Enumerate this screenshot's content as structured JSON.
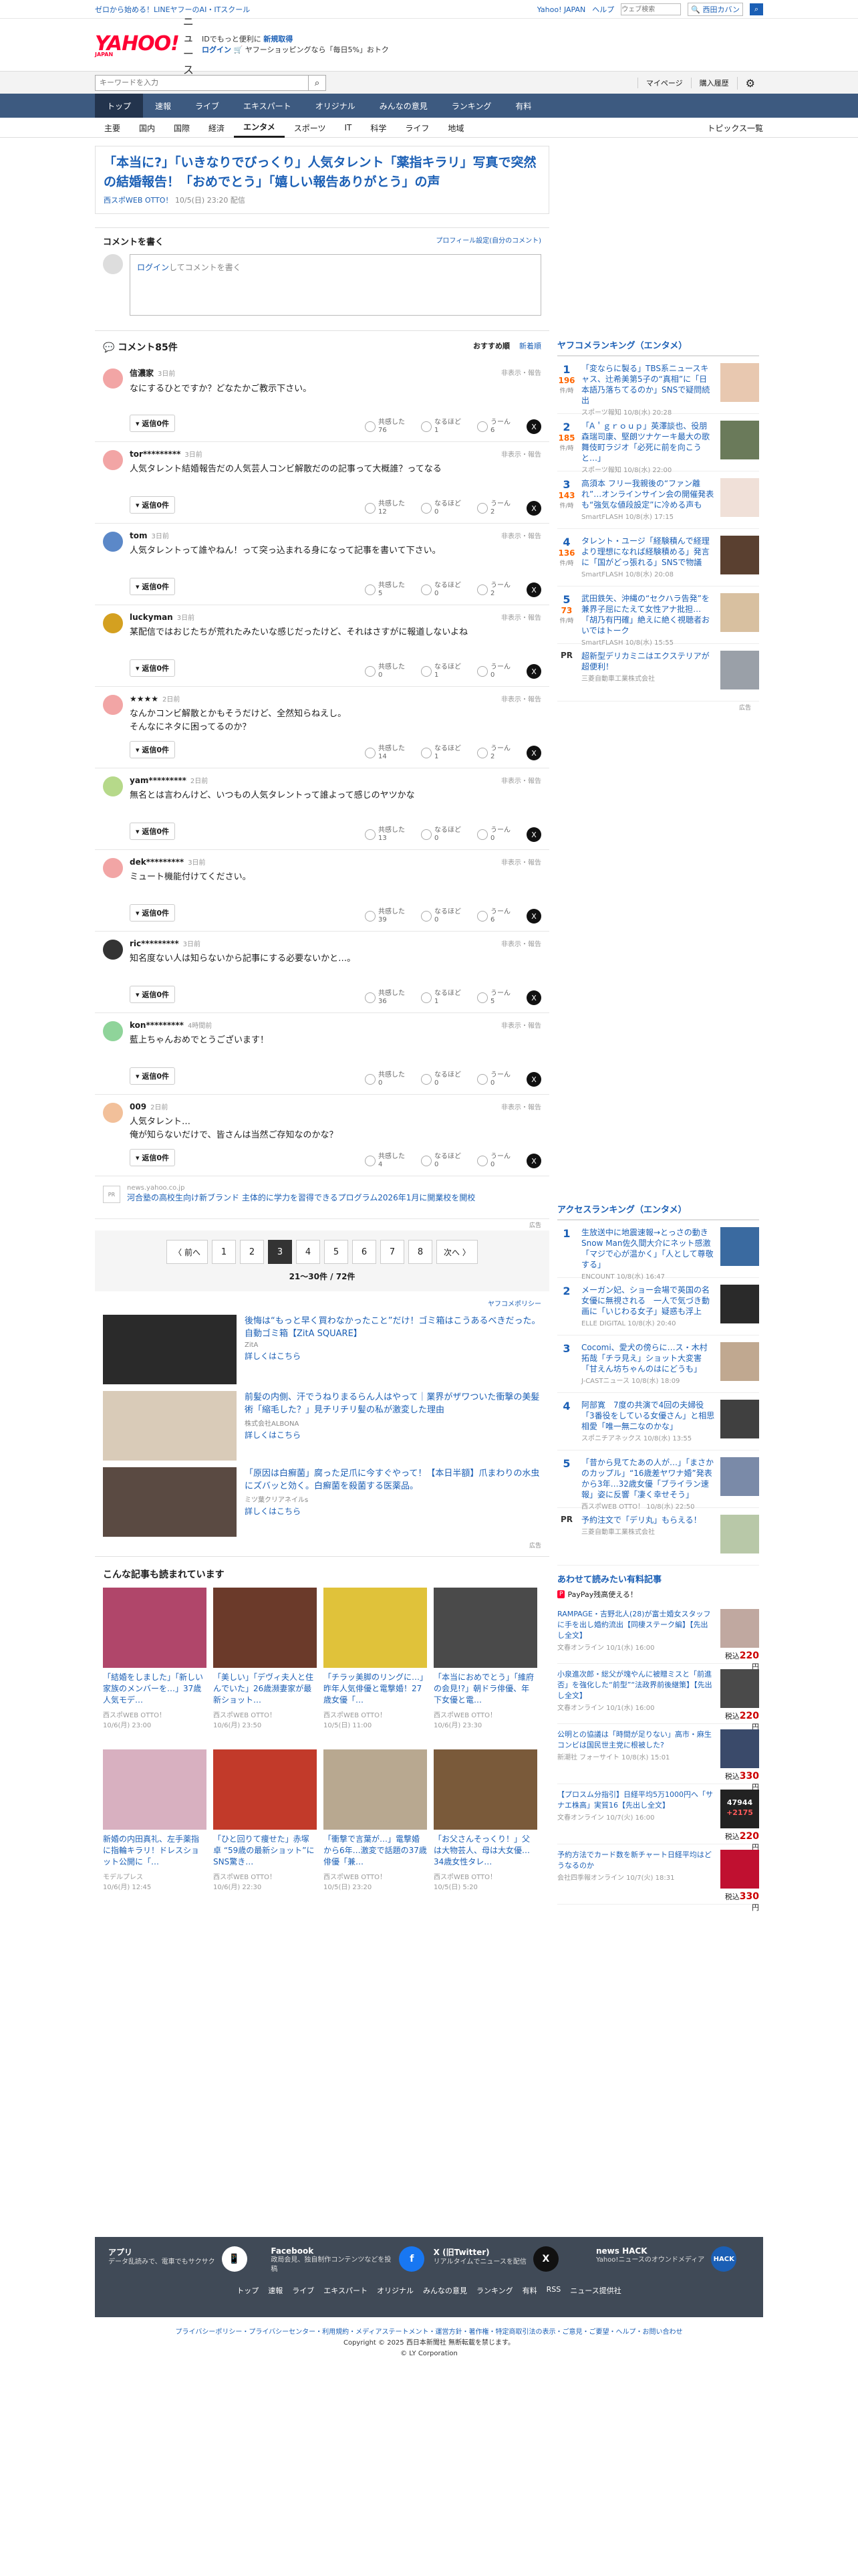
{
  "topbar": {
    "left": "ゼロから始める！LINEヤフーのAI・ITスクール",
    "links": [
      "Yahoo! JAPAN",
      "ヘルプ"
    ],
    "search_placeholder": "ウェブ検索",
    "search_select": "🔍 西田カバン"
  },
  "header": {
    "logo": "YAHOO!",
    "logo_sub": "JAPAN",
    "news": "ニュース",
    "promo_line1": "IDでもっと便利に",
    "promo_new": "新規取得",
    "promo_login": "ログイン",
    "promo_line2": "🛒 ヤフーショッピングなら「毎日5%」おトク"
  },
  "search": {
    "placeholder": "キーワードを入力",
    "right_links": [
      "マイページ",
      "購入履歴"
    ]
  },
  "gnav": [
    "トップ",
    "速報",
    "ライブ",
    "エキスパート",
    "オリジナル",
    "みんなの意見",
    "ランキング",
    "有料"
  ],
  "lnav": [
    "主要",
    "国内",
    "国際",
    "経済",
    "エンタメ",
    "スポーツ",
    "IT",
    "科学",
    "ライフ",
    "地域"
  ],
  "lnav_more": "トピックス一覧",
  "article": {
    "title": "「本当に?」「いきなりでびっくり」人気タレント「薬指キラリ」写真で突然の結婚報告！「おめでとう」「嬉しい報告ありがとう」の声",
    "source": "西スポWEB OTTO！",
    "date": "10/5(日) 23:20 配信"
  },
  "comment_form": {
    "title": "コメントを書く",
    "profile_link": "プロフィール設定(自分のコメント)",
    "login": "ログイン",
    "placeholder": "してコメントを書く"
  },
  "comment_list": {
    "count_label": "コメント85件",
    "sort_on": "おすすめ順",
    "sort_off": "新着順",
    "reply": "返信0件",
    "hide": "非表示・報告",
    "react_labels": [
      "共感した",
      "なるほど",
      "うーん"
    ]
  },
  "comments": [
    {
      "name": "信濃家",
      "time": "3日前",
      "body": "なにするひとですか？どなたかご教示下さい。",
      "r1": "76",
      "r2": "1",
      "r3": "6",
      "color": "#f2a5a5"
    },
    {
      "name": "tor*********",
      "time": "3日前",
      "body": "人気タレント結婚報告だの人気芸人コンビ解散だのの記事って大概誰？ってなる",
      "r1": "12",
      "r2": "0",
      "r3": "2",
      "color": "#f2a5a5"
    },
    {
      "name": "tom",
      "time": "3日前",
      "body": "人気タレントって誰やねん！って突っ込まれる身になって記事を書いて下さい。",
      "r1": "5",
      "r2": "0",
      "r3": "2",
      "color": "#5b88c8"
    },
    {
      "name": "luckyman",
      "time": "3日前",
      "body": "某配信ではおじたちが荒れたみたいな感じだったけど、それはさすがに報道しないよね",
      "r1": "0",
      "r2": "1",
      "r3": "0",
      "color": "#d4a020"
    },
    {
      "name": "★★★★",
      "time": "2日前",
      "body": "なんかコンビ解散とかもそうだけど、全然知らねえし。\nそんなにネタに困ってるのか？",
      "r1": "14",
      "r2": "1",
      "r3": "2",
      "color": "#f2a5a5"
    },
    {
      "name": "yam*********",
      "time": "2日前",
      "body": "無名とは言わんけど、いつもの人気タレントって誰よって感じのヤツかな",
      "r1": "13",
      "r2": "0",
      "r3": "0",
      "color": "#b6d98a"
    },
    {
      "name": "dek*********",
      "time": "3日前",
      "body": "ミュート機能付けてください。",
      "r1": "39",
      "r2": "0",
      "r3": "6",
      "color": "#f2a5a5"
    },
    {
      "name": "ric*********",
      "time": "3日前",
      "body": "知名度ない人は知らないから記事にする必要ないかと…。",
      "r1": "36",
      "r2": "1",
      "r3": "5",
      "color": "#333333"
    },
    {
      "name": "kon*********",
      "time": "4時間前",
      "body": "藍上ちゃんおめでとうございます！",
      "r1": "0",
      "r2": "0",
      "r3": "0",
      "color": "#8fd49a"
    },
    {
      "name": "009",
      "time": "2日前",
      "body": "人気タレント…\n俺が知らないだけで、皆さんは当然ご存知なのかな？",
      "r1": "4",
      "r2": "0",
      "r3": "0",
      "color": "#f2c09a"
    }
  ],
  "inline_ad": {
    "icon": "PR",
    "source": "news.yahoo.co.jp",
    "text": "河合塾の高校生向け新ブランド 主体的に学力を習得できるプログラム2026年1月に開業校を開校",
    "label": "広告"
  },
  "pager": {
    "prev": "〈 前へ",
    "pages": [
      "1",
      "2",
      "3",
      "4",
      "5",
      "6",
      "7",
      "8"
    ],
    "current": "3",
    "next": "次へ 〉",
    "info": "21～30件 / 72件"
  },
  "ads": {
    "policy": "ヤフコメポリシー",
    "items": [
      {
        "title": "後悔は“もっと早く買わなかったこと”だけ！ゴミ箱はこうあるべきだった。自動ゴミ箱【ZitA SQUARE】",
        "sponsor": "ZitA",
        "more": "詳しくはこちら",
        "img": "#2a2a2a"
      },
      {
        "title": "前髪の内側、汗でうねりまるらん人はやって｜業界がザワついた衝撃の美髪術「縮毛した？」見チリチリ髪の私が激変した理由",
        "sponsor": "株式会社ALBONA",
        "more": "詳しくはこちら",
        "img": "#d9cbb8"
      },
      {
        "title": "「原因は白癬菌」腐った足爪に今すぐやって！【本日半額】爪まわりの水虫にズバッと効く。白癬菌を殺菌する医薬品。",
        "sponsor": "ミツ葉クリアネイルs",
        "more": "詳しくはこちら",
        "img": "#5a4a42"
      }
    ],
    "label": "広告"
  },
  "recommend": {
    "title": "こんな記事も読まれています",
    "items": [
      {
        "title": "「結婚をしました」「新しい家族のメンバーを…」37歳人気モデ…",
        "src": "西スポWEB OTTO！",
        "date": "10/6(月) 23:00",
        "img": "#b0466a"
      },
      {
        "title": "「美しい」「デヴィ夫人と住んでいた」26歳瀕妻家が最新ショット…",
        "src": "西スポWEB OTTO！",
        "date": "10/6(月) 23:50",
        "img": "#6b3a2a"
      },
      {
        "title": "「チラッ美脚のリングに…」昨年人気俳優と電撃婚！27歳女優「…",
        "src": "西スポWEB OTTO！",
        "date": "10/5(日) 11:00",
        "img": "#e0c23a"
      },
      {
        "title": "「本当におめでとう」「維府の会見!?」朝ドラ俳優、年下女優と電…",
        "src": "西スポWEB OTTO！",
        "date": "10/6(月) 23:30",
        "img": "#4a4a4a"
      },
      {
        "title": "新婚の内田真礼、左手薬指に指輪キラリ！ドレスショット公開に「…",
        "src": "モデルプレス",
        "date": "10/6(月) 12:45",
        "img": "#d8b0c0"
      },
      {
        "title": "「ひと回りて痩せた」赤塚卓 “59歳の最新ショット”に SNS驚き…",
        "src": "西スポWEB OTTO！",
        "date": "10/6(月) 22:30",
        "img": "#c23a2a"
      },
      {
        "title": "「衝撃で言葉が…」電撃婚から6年…激変で話題の37歳俳優「兼…",
        "src": "西スポWEB OTTO！",
        "date": "10/5(日) 23:20",
        "img": "#b8a890"
      },
      {
        "title": "「お父さんそっくり！」父は大物芸人、母は大女優…34歳女性タレ…",
        "src": "西スポWEB OTTO！",
        "date": "10/5(日) 5:20",
        "img": "#7a5a3a"
      }
    ]
  },
  "side": {
    "ranking_title": "ヤフコメランキング（エンタメ）",
    "unit": "件/時",
    "ranking": [
      {
        "n": "1",
        "c": "196",
        "title": "「変ならに製る」TBS系ニュースキャス、辻希美第5子の“真相”に「日本語乃落ちてるのか」SNSで疑問続出",
        "src": "スポーツ報知 10/8(水) 20:28",
        "img": "#e8c8b0"
      },
      {
        "n": "2",
        "c": "185",
        "title": "「A＇ｇｒｏｕｐ」英澤談也、役朋森瑞司康、堅朗ツナケーキ最大の歌舞伎町ラジオ「必死に前を向こうと…」",
        "src": "スポーツ報知 10/8(水) 22:00",
        "img": "#6a7a5a"
      },
      {
        "n": "3",
        "c": "143",
        "title": "高須本 フリー我親後の“ファン離れ”…オンラインサイン会の開催発表も“強気な値段設定”に冷める声も",
        "src": "SmartFLASH 10/8(水) 17:15",
        "img": "#f0e0d8"
      },
      {
        "n": "4",
        "c": "136",
        "title": "タレント・ユージ「経験積んで経理より理想になれば経験積める」発言に「国がどっ張れる」SNSで物議",
        "src": "SmartFLASH 10/8(水) 20:08",
        "img": "#5a4030"
      },
      {
        "n": "5",
        "c": "73",
        "title": "武田鉄矢、沖縄の“セクハラ告発”を兼界子屈にたえて女性アナ批担…「胡乃有円確」絶えに絶く視聴者おいではトーク",
        "src": "SmartFLASH 10/8(水) 15:55",
        "img": "#d8c0a0"
      }
    ],
    "pr": {
      "label": "PR",
      "title": "超新型デリカミニはエクステリアが超便利！",
      "src": "三菱自動車工業株式会社",
      "img": "#9aa0a8"
    },
    "access_title": "アクセスランキング（エンタメ）",
    "access": [
      {
        "n": "1",
        "title": "生放送中に地震速報→とっさの動き　Snow Man佐久間大介にネット感激「マジで心が温かく」「人として尊敬する」",
        "src": "ENCOUNT 10/8(水) 16:47",
        "img": "#3a6aa0"
      },
      {
        "n": "2",
        "title": "メーガン妃、ショー会場で英国の名女優に無視される　一人で気づき動画に「いじわる女子」疑惑も浮上",
        "src": "ELLE DIGITAL 10/8(水) 20:40",
        "img": "#2a2a2a"
      },
      {
        "n": "3",
        "title": "Cocomi、愛犬の傍らに…ス・木村拓哉「チラ見え」ショット大変害「甘えん坊ちゃんのはにどうも」",
        "src": "J-CASTニュース 10/8(水) 18:09",
        "img": "#c0a890"
      },
      {
        "n": "4",
        "title": "阿部寛　7度の共演で4回の夫婦役「3番役をしている女優さん」と相思相愛「唯一無二なのかな」",
        "src": "スポニチアネックス 10/8(水) 13:55",
        "img": "#404040"
      },
      {
        "n": "5",
        "title": "「昔から見てたあの人が…」「まさかのカップル」“16歳差ヤワナ婚”発表から3年…32歳女優「ブライラン速報」姿に反響「凄く幸せそう」",
        "src": "西スポWEB OTTO！ 10/8(水) 22:50",
        "img": "#7a8aa8"
      }
    ],
    "pr2": {
      "label": "PR",
      "title": "予約注文で「デリ丸」もらえる！",
      "src": "三菱自動車工業株式会社",
      "img": "#b8c8a8"
    },
    "paid_title": "あわせて読みたい有料記事",
    "paypay": "PayPay残高使える！",
    "pp": "P",
    "paid": [
      {
        "title": "RAMPAGE・吉野北人(28)が富士婚女スタッフに手を出し婚約流出【同棲ステーク編】【先出し全文】",
        "src": "文春オンライン 10/1(水) 16:00",
        "price": "220",
        "img": "#c0a8a0"
      },
      {
        "title": "小泉進次郎・総父が塊やんに被贈ミスと「前進否」を強化した“前型”“法政界前後継策】【先出し全文】",
        "src": "文春オンライン 10/1(水) 16:00",
        "price": "220",
        "img": "#4a4a4a"
      },
      {
        "title": "公明との協議は「時間が足りない」高市・麻生コンビは国民世主党に根被した?",
        "src": "新潮社 フォーサイト 10/8(水) 15:01",
        "price": "330",
        "img": "#3a4a6a"
      },
      {
        "title": "【プロスム分指引】日経平均5万1000円へ「サナエ株高」実質16【先出し全文】",
        "src": "文春オンライン 10/7(火) 16:00",
        "price": "220",
        "img": "#222222",
        "stock": "47944",
        "chg": "+2175"
      },
      {
        "title": "予約方法でカード数を新チャート日経平均はどうなるのか",
        "src": "会社四季報オンライン 10/7(火) 18:31",
        "price": "330",
        "img": "#c01030"
      }
    ],
    "yen": "税込",
    "ad_label": "広告"
  },
  "footer": {
    "social": [
      {
        "t": "アプリ",
        "d": "データ乱読みで、電車でもサクサク",
        "icon": "📱",
        "bg": "#ffffff",
        "fg": "#333333"
      },
      {
        "t": "Facebook",
        "d": "政局会見、独自制作コンテンツなどを投稿",
        "icon": "f",
        "bg": "#1877f2",
        "fg": "#ffffff"
      },
      {
        "t": "X (旧Twitter)",
        "d": "リアルタイムでニュースを配信",
        "icon": "X",
        "bg": "#111111",
        "fg": "#ffffff"
      },
      {
        "t": "news HACK",
        "d": "Yahoo!ニュースのオウンドメディア",
        "icon": "HACK",
        "bg": "#1b5fb5",
        "fg": "#ffffff"
      }
    ],
    "links": [
      "トップ",
      "速報",
      "ライブ",
      "エキスパート",
      "オリジナル",
      "みんなの意見",
      "ランキング",
      "有料",
      "RSS",
      "ニュース提供社"
    ],
    "legal": "プライバシーポリシー・プライバシーセンター・利用規約・メディアステートメント・運営方針・著作権・特定商取引法の表示・ご意見・ご要望・ヘルプ・お問い合わせ",
    "copy1": "Copyright © 2025 西日本新聞社 無断転載を禁じます。",
    "copy2": "© LY Corporation"
  }
}
